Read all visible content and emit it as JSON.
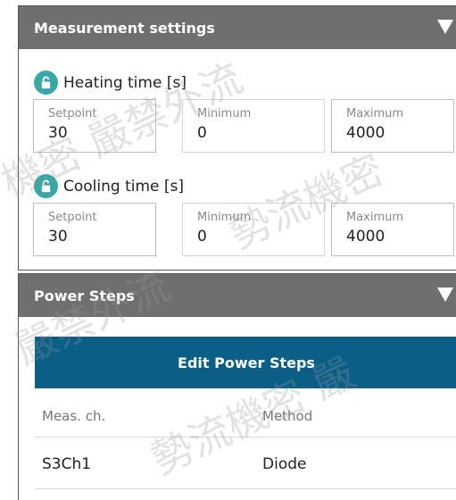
{
  "measurement": {
    "title": "Measurement settings",
    "heating": {
      "label": "Heating time [s]",
      "setpoint_label": "Setpoint",
      "setpoint": "30",
      "min_label": "Minimum",
      "min": "0",
      "max_label": "Maximum",
      "max": "4000"
    },
    "cooling": {
      "label": "Cooling time [s]",
      "setpoint_label": "Setpoint",
      "setpoint": "30",
      "min_label": "Minimum",
      "min": "0",
      "max_label": "Maximum",
      "max": "4000"
    }
  },
  "power": {
    "title": "Power Steps",
    "edit_label": "Edit Power Steps",
    "columns": [
      "Meas. ch.",
      "Method"
    ],
    "rows": [
      [
        "S3Ch1",
        "Diode"
      ]
    ]
  },
  "watermark": [
    "機密 嚴禁外流",
    "勢流機密",
    "嚴禁外流",
    "勢流機密 嚴"
  ],
  "colors": {
    "header_bg": "#6f6f6f",
    "button_bg": "#0b5f87",
    "lock_icon": "#3aa6a6"
  }
}
